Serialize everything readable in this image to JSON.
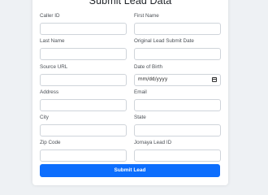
{
  "form": {
    "title": "Submit Lead Data",
    "fields": {
      "caller_id": {
        "label": "Caller ID",
        "value": ""
      },
      "first_name": {
        "label": "First Name",
        "value": ""
      },
      "last_name": {
        "label": "Last Name",
        "value": ""
      },
      "original_lead_submit_date": {
        "label": "Original Lead Submit Date",
        "value": ""
      },
      "source_url": {
        "label": "Source URL",
        "value": ""
      },
      "date_of_birth": {
        "label": "Date of Birth",
        "placeholder": "mm/dd/yyyy",
        "icon": "calendar-icon"
      },
      "address": {
        "label": "Address",
        "value": ""
      },
      "email": {
        "label": "Email",
        "value": ""
      },
      "city": {
        "label": "City",
        "value": ""
      },
      "state": {
        "label": "State",
        "value": ""
      },
      "zip_code": {
        "label": "Zip Code",
        "value": ""
      },
      "jornaya_lead_id": {
        "label": "Jornaya Lead ID",
        "value": ""
      }
    },
    "submit_label": "Submit Lead",
    "accent_color": "#0d6efd"
  }
}
